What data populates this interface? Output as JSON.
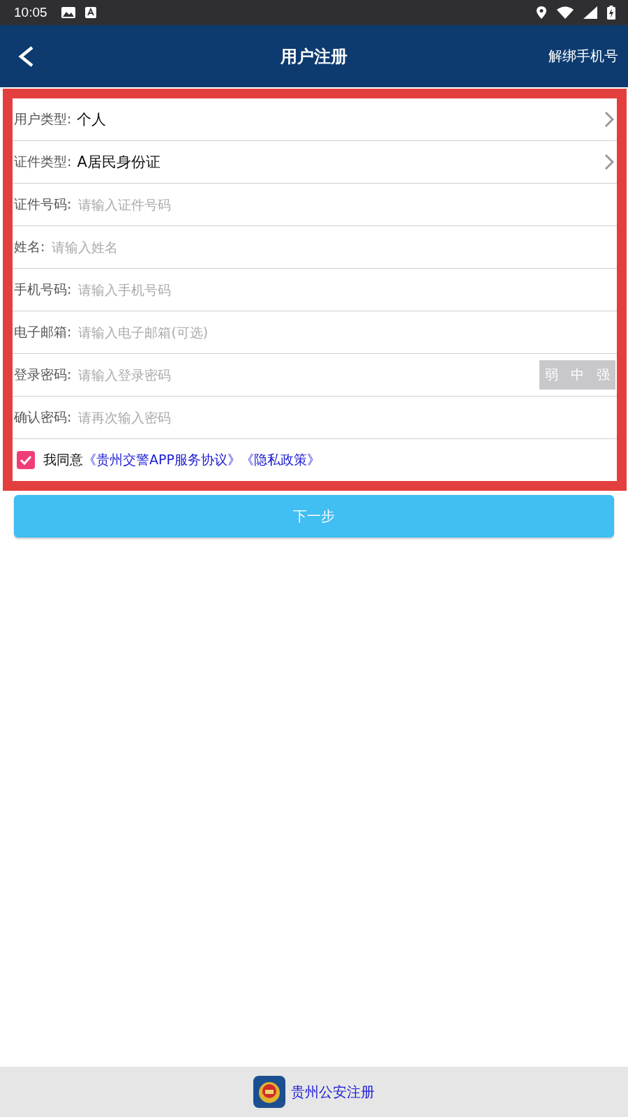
{
  "status_bar": {
    "time": "10:05"
  },
  "header": {
    "title": "用户注册",
    "action": "解绑手机号"
  },
  "form": {
    "rows": [
      {
        "kind": "select",
        "label": "用户类型:",
        "value": "个人"
      },
      {
        "kind": "select",
        "label": "证件类型:",
        "value": "A居民身份证"
      },
      {
        "kind": "input",
        "label": "证件号码:",
        "placeholder": "请输入证件号码"
      },
      {
        "kind": "input",
        "label": "姓名:",
        "placeholder": "请输入姓名"
      },
      {
        "kind": "input",
        "label": "手机号码:",
        "placeholder": "请输入手机号码"
      },
      {
        "kind": "input",
        "label": "电子邮箱:",
        "placeholder": "请输入电子邮箱(可选)"
      },
      {
        "kind": "password",
        "label": "登录密码:",
        "placeholder": "请输入登录密码",
        "strength": [
          "弱",
          "中",
          "强"
        ]
      },
      {
        "kind": "input",
        "label": "确认密码:",
        "placeholder": "请再次输入密码"
      }
    ],
    "agreement": {
      "checked": true,
      "text": "我同意",
      "links": [
        "《贵州交警APP服务协议》",
        "《隐私政策》"
      ]
    }
  },
  "next_button": "下一步",
  "footer": {
    "label": "贵州公安注册"
  }
}
